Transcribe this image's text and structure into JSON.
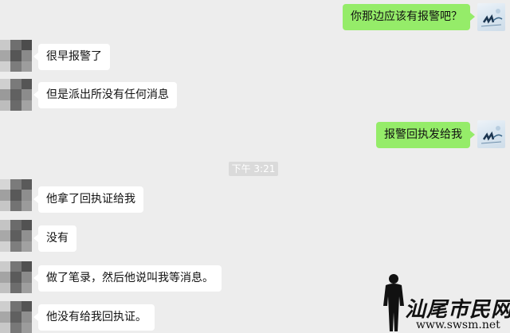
{
  "messages": [
    {
      "side": "right",
      "text": "你那边应该有报警吧？"
    },
    {
      "side": "left",
      "text": "很早报警了"
    },
    {
      "side": "left",
      "text": "但是派出所没有任何消息"
    },
    {
      "side": "right",
      "text": "报警回执发给我"
    },
    {
      "side": "left",
      "text": "他拿了回执证给我"
    },
    {
      "side": "left",
      "text": "没有"
    },
    {
      "side": "left",
      "text": "做了笔录，然后他说叫我等消息。"
    },
    {
      "side": "left",
      "text": "他没有给我回执证。"
    }
  ],
  "timestamp": "下午 3:21",
  "watermark": {
    "title": "汕尾市民网",
    "url": "www.swsm.net"
  },
  "colors": {
    "background": "#ededed",
    "bubble_self": "#95ec69",
    "bubble_other": "#ffffff"
  },
  "icons": {
    "contact_avatar": "blurred-avatar",
    "self_avatar": "profile-avatar",
    "watermark_figure": "person-silhouette"
  }
}
